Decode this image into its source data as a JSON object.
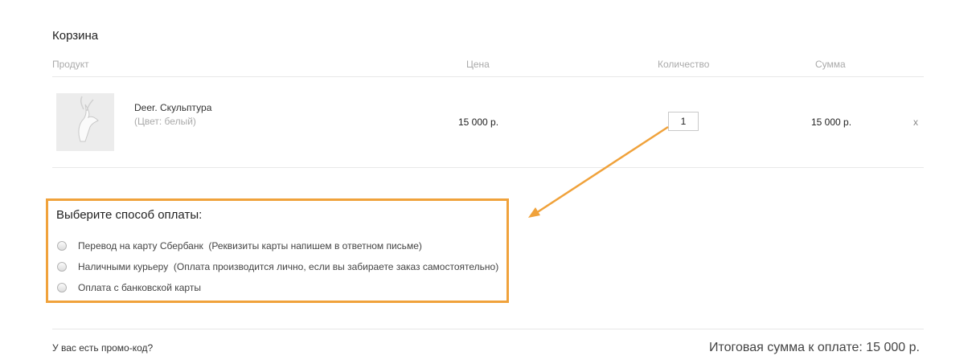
{
  "cart": {
    "title": "Корзина",
    "columns": {
      "product": "Продукт",
      "price": "Цена",
      "quantity": "Количество",
      "sum": "Сумма"
    },
    "items": [
      {
        "name": "Deer. Скульптура",
        "option": "(Цвет: белый)",
        "price": "15 000 р.",
        "quantity": "1",
        "sum": "15 000 р.",
        "remove_label": "x"
      }
    ]
  },
  "payment": {
    "title": "Выберите способ оплаты:",
    "options": [
      {
        "label": "Перевод на карту Сбербанк  (Реквизиты карты напишем в ответном письме)"
      },
      {
        "label": "Наличными курьеру  (Оплата производится лично, если вы забираете заказ самостоятельно)"
      },
      {
        "label": "Оплата с банковской карты"
      }
    ]
  },
  "footer": {
    "promo_link": "У вас есть промо-код?",
    "total": "Итоговая сумма к оплате: 15 000 р."
  },
  "colors": {
    "highlight": "#f0a23b"
  }
}
